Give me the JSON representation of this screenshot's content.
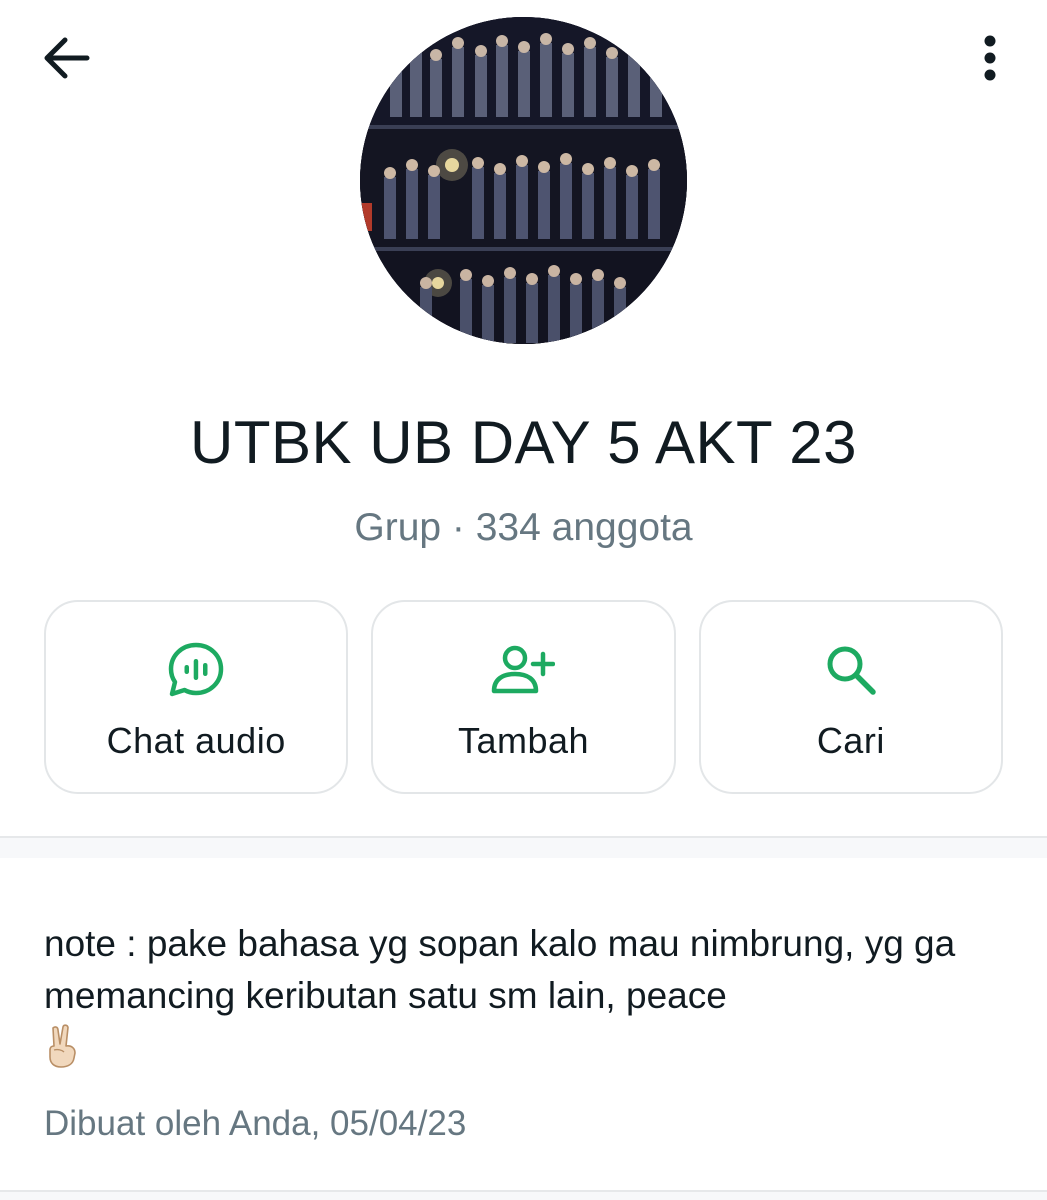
{
  "icons": {
    "back": "arrow-left-icon",
    "menu": "more-vertical-icon",
    "audio_chat": "audio-chat-icon",
    "add": "person-add-icon",
    "search": "search-icon"
  },
  "colors": {
    "accent": "#1daa61",
    "text": "#111b21",
    "secondary": "#667781",
    "border": "#e3e6e8"
  },
  "group": {
    "name": "UTBK UB DAY 5 AKT 23",
    "subtitle": "Grup · 334 anggota"
  },
  "actions": [
    {
      "label": "Chat audio",
      "icon": "audio-chat-icon"
    },
    {
      "label": "Tambah",
      "icon": "person-add-icon"
    },
    {
      "label": "Cari",
      "icon": "search-icon"
    }
  ],
  "description": {
    "text": "note : pake bahasa yg sopan kalo mau nimbrung, yg ga memancing keributan satu sm lain, peace",
    "emoji": "victory-hand-emoji",
    "created": "Dibuat oleh Anda, 05/04/23"
  }
}
